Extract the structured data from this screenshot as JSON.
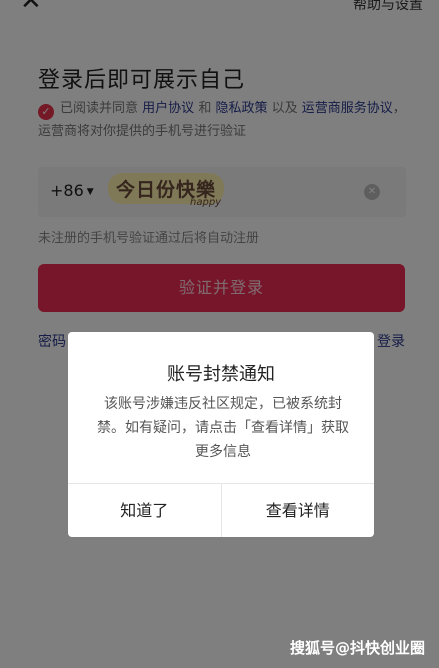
{
  "header": {
    "close_icon": "close-icon",
    "help_label": "帮助与设置"
  },
  "login": {
    "title": "登录后即可展示自己",
    "agreement": {
      "prefix": "已阅读并同意",
      "user_agreement": "用户协议",
      "and": "和",
      "privacy": "隐私政策",
      "and2": "以及",
      "carrier_service": "运营商服务协议",
      "suffix": "，运营商将对你提供的手机号进行验证"
    },
    "country_code": "+86",
    "sticker_main": "今日份快樂",
    "sticker_sub": "happy",
    "hint": "未注册的手机号验证通过后将自动注册",
    "login_button": "验证并登录",
    "password_login": "密码",
    "other_login": "登录"
  },
  "dialog": {
    "title": "账号封禁通知",
    "body": "该账号涉嫌违反社区规定，已被系统封禁。如有疑问，请点击「查看详情」获取更多信息",
    "ok": "知道了",
    "details": "查看详情"
  },
  "watermark": "搜狐号@抖快创业圈",
  "colors": {
    "accent": "#ee2c55",
    "link": "#2d3b8f"
  }
}
